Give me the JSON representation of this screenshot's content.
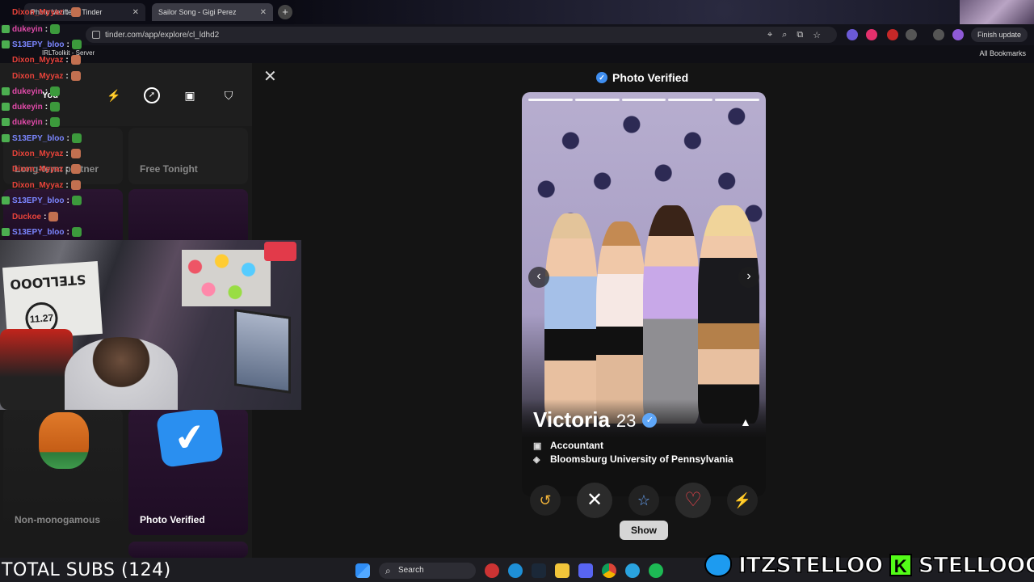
{
  "browser": {
    "tabs": [
      {
        "label": "Photo Verified | Tinder",
        "active": false
      },
      {
        "label": "Sailor Song - Gigi Perez",
        "active": true
      }
    ],
    "url": "tinder.com/app/explore/cl_ldhd2",
    "finish_update_label": "Finish update",
    "bookmark_left": "IRLToolkit - Server",
    "all_bookmarks_label": "All Bookmarks"
  },
  "chat": [
    {
      "user": "Dixon_Myyaz",
      "color": "#e8433a"
    },
    {
      "user": "dukeyin",
      "color": "#e04aa8"
    },
    {
      "user": "S13EPY_bloo",
      "color": "#7b86ff"
    },
    {
      "user": "Dixon_Myyaz",
      "color": "#e8433a"
    },
    {
      "user": "Dixon_Myyaz",
      "color": "#e8433a"
    },
    {
      "user": "dukeyin",
      "color": "#e04aa8"
    },
    {
      "user": "dukeyin",
      "color": "#e04aa8"
    },
    {
      "user": "dukeyin",
      "color": "#e04aa8"
    },
    {
      "user": "S13EPY_bloo",
      "color": "#7b86ff"
    },
    {
      "user": "Dixon_Myyaz",
      "color": "#e8433a"
    },
    {
      "user": "Dixon_Myyaz",
      "color": "#e8433a"
    },
    {
      "user": "Dixon_Myyaz",
      "color": "#e8433a"
    },
    {
      "user": "S13EPY_bloo",
      "color": "#7b86ff"
    },
    {
      "user": "Duckoe",
      "color": "#e8433a"
    },
    {
      "user": "S13EPY_bloo",
      "color": "#7b86ff"
    }
  ],
  "sidebar": {
    "header_partial": "You",
    "cards": {
      "partner": "Long-term partner",
      "free_tonight": "Free Tonight",
      "non_monogamous": "Non-monogamous",
      "photo_verified": "Photo Verified"
    }
  },
  "webcam": {
    "sign_text": "STELLOOO",
    "sign_number": "11.27"
  },
  "profile": {
    "header": "Photo Verified",
    "name": "Victoria",
    "age": "23",
    "job": "Accountant",
    "school": "Bloomsburg University of Pennsylvania",
    "photo_count": 5,
    "current_photo": 5
  },
  "actions": {
    "show_label": "Show"
  },
  "overlay": {
    "total_subs": "TOTAL SUBS (124)",
    "twitter_handle": "ITZSTELLOO",
    "kick_letter": "K",
    "kick_handle": "STELLOOO"
  },
  "taskbar": {
    "search_label": "Search"
  },
  "colors": {
    "tinder_blue": "#3f8ef0",
    "like_red": "#f0444c",
    "superlike_blue": "#6aa8ff",
    "boost_purple": "#d68ef0",
    "kick_green": "#53fc18",
    "twitter_blue": "#1d9bf0"
  }
}
